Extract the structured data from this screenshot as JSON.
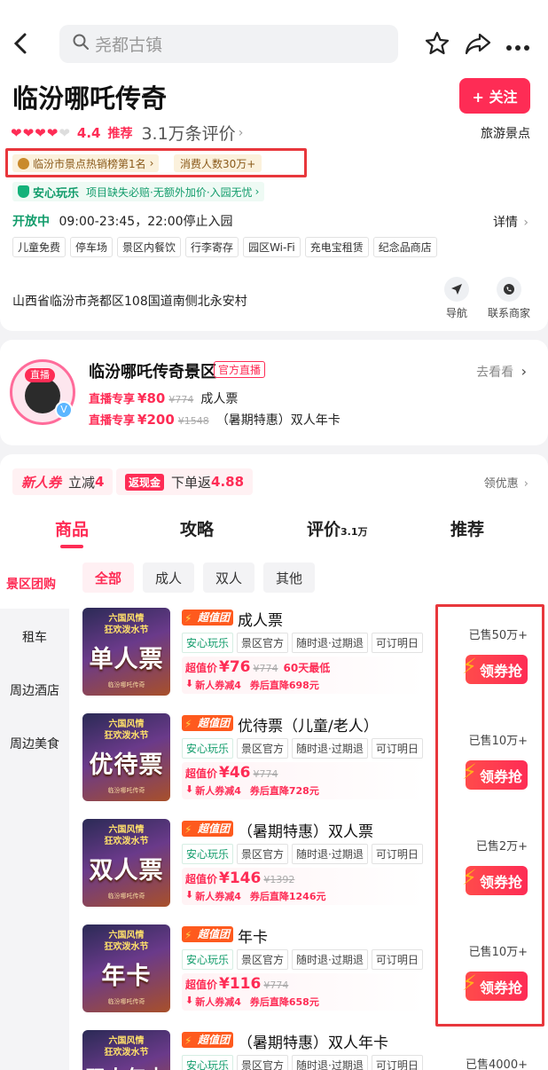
{
  "header": {
    "search_placeholder": "尧都古镇",
    "title": "临汾哪吒传奇",
    "follow_label": "+ 关注",
    "hearts": 4,
    "score": "4.4",
    "recommend": "推荐",
    "reviews": "3.1万条评价",
    "category": "旅游景点",
    "rank_tag": "临汾市景点热销榜第1名",
    "consumer_tag": "消费人数30万+",
    "safe_title": "安心玩乐",
    "safe_desc": "项目缺失必赔·无额外加价·入园无忧",
    "open_status": "开放中",
    "open_hours": "09:00-23:45，22:00停止入园",
    "detail_label": "详情",
    "facilities": [
      "儿童免费",
      "停车场",
      "景区内餐饮",
      "行李寄存",
      "园区Wi-Fi",
      "充电宝租赁",
      "纪念品商店"
    ],
    "address": "山西省临汾市尧都区108国道南侧北永安村",
    "nav_label": "导航",
    "contact_label": "联系商家"
  },
  "live": {
    "name": "临汾哪吒传奇景区",
    "tag": "官方直播",
    "goto": "去看看",
    "live_badge": "直播",
    "items": [
      {
        "label": "直播专享",
        "price": "¥80",
        "orig": "¥774",
        "name": "成人票"
      },
      {
        "label": "直播专享",
        "price": "¥200",
        "orig": "¥1548",
        "name": "（暑期特惠）双人年卡"
      }
    ]
  },
  "coupons": {
    "new_label": "新人券",
    "new_text": "立减",
    "new_value": "4",
    "cash_label": "返现金",
    "cash_text": "下单返",
    "cash_value": "4.88",
    "get_label": "领优惠"
  },
  "tabs": [
    {
      "label": "商品",
      "sub": ""
    },
    {
      "label": "攻略",
      "sub": ""
    },
    {
      "label": "评价",
      "sub": "3.1万"
    },
    {
      "label": "推荐",
      "sub": ""
    }
  ],
  "sidebar": [
    "景区团购",
    "租车",
    "周边酒店",
    "周边美食"
  ],
  "filters": [
    "全部",
    "成人",
    "双人",
    "其他"
  ],
  "products": [
    {
      "thumb_big": "单人票",
      "thumb_small": "六国风情\n狂欢泼水节",
      "thumb_tiny": "临汾哪吒传奇",
      "badge": "超值团",
      "name": "成人票",
      "tags": [
        "安心玩乐",
        "景区官方",
        "随时退·过期退",
        "可订明日"
      ],
      "price_label": "超值价",
      "price": "¥76",
      "orig": "¥774",
      "note": "60天最低",
      "coupon": "新人券减4",
      "after": "券后直降698元",
      "sold": "已售50万+",
      "grab": "领券抢"
    },
    {
      "thumb_big": "优待票",
      "thumb_small": "六国风情\n狂欢泼水节",
      "thumb_tiny": "临汾哪吒传奇",
      "badge": "超值团",
      "name": "优待票（儿童/老人）",
      "tags": [
        "安心玩乐",
        "景区官方",
        "随时退·过期退",
        "可订明日"
      ],
      "price_label": "超值价",
      "price": "¥46",
      "orig": "¥774",
      "note": "",
      "coupon": "新人券减4",
      "after": "券后直降728元",
      "sold": "已售10万+",
      "grab": "领券抢"
    },
    {
      "thumb_big": "双人票",
      "thumb_small": "六国风情\n狂欢泼水节",
      "thumb_tiny": "临汾哪吒传奇",
      "badge": "超值团",
      "name": "（暑期特惠）双人票",
      "tags": [
        "安心玩乐",
        "景区官方",
        "随时退·过期退",
        "可订明日"
      ],
      "price_label": "超值价",
      "price": "¥146",
      "orig": "¥1392",
      "note": "",
      "coupon": "新人券减4",
      "after": "券后直降1246元",
      "sold": "已售2万+",
      "grab": "领券抢"
    },
    {
      "thumb_big": "年卡",
      "thumb_small": "六国风情\n狂欢泼水节",
      "thumb_tiny": "临汾哪吒传奇",
      "badge": "超值团",
      "name": "年卡",
      "tags": [
        "安心玩乐",
        "景区官方",
        "随时退·过期退",
        "可订明日"
      ],
      "price_label": "超值价",
      "price": "¥116",
      "orig": "¥774",
      "note": "",
      "coupon": "新人券减4",
      "after": "券后直降658元",
      "sold": "已售10万+",
      "grab": "领券抢"
    },
    {
      "thumb_big": "双人年卡",
      "thumb_small": "六国风情\n狂欢泼水节",
      "thumb_tiny": "",
      "badge": "超值团",
      "name": "（暑期特惠）双人年卡",
      "tags": [
        "安心玩乐",
        "景区官方",
        "随时退·过期退",
        "可订明日"
      ],
      "price_label": "",
      "price": "",
      "orig": "",
      "note": "",
      "coupon": "",
      "after": "",
      "sold": "已售4000+",
      "grab": ""
    }
  ],
  "colors": {
    "accent": "#fe2c55",
    "green": "#129c6b",
    "highlight": "#e8373c"
  }
}
